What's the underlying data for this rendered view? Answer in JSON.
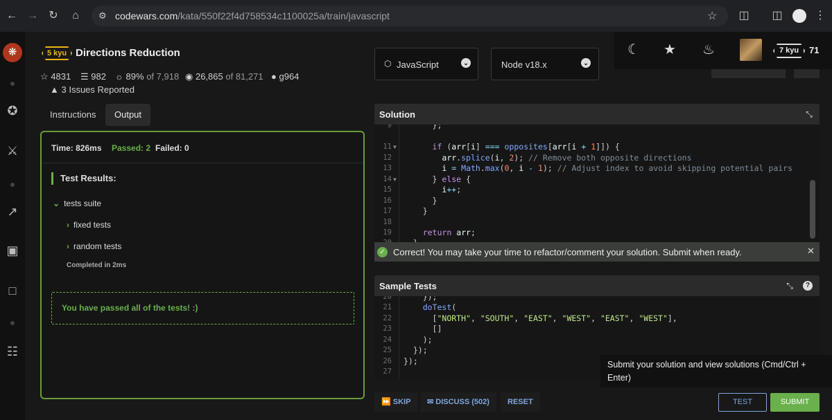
{
  "browser": {
    "url_host": "codewars.com",
    "url_path": "/kata/550f22f4d758534c1100025a/train/javascript"
  },
  "kata": {
    "rank": "5 kyu",
    "title": "Directions Reduction",
    "stars": "4831",
    "collections": "982",
    "satisfaction": "89%",
    "satisfaction_of": "of 7,918",
    "completed": "26,865",
    "completed_of": "of 81,271",
    "author": "g964",
    "issues": "3 Issues Reported"
  },
  "tabs": {
    "instructions": "Instructions",
    "output": "Output"
  },
  "output": {
    "time": "Time: 826ms",
    "passed": "Passed: 2",
    "failed": "Failed: 0",
    "results_header": "Test Results:",
    "suite": "tests suite",
    "fixed": "fixed tests",
    "random": "random tests",
    "completed_in": "Completed in 2ms",
    "pass_msg": "You have passed all of the tests! :)"
  },
  "selectors": {
    "language": "JavaScript",
    "version": "Node v18.x"
  },
  "user": {
    "rank": "7 kyu",
    "honor": "71"
  },
  "solution": {
    "title": "Solution",
    "success": "Correct! You may take your time to refactor/comment your solution. Submit when ready."
  },
  "sample_tests": {
    "title": "Sample Tests"
  },
  "tooltip": "Submit your solution and view solutions (Cmd/Ctrl + Enter)",
  "actions": {
    "skip": "SKIP",
    "discuss": "DISCUSS (502)",
    "reset": "RESET",
    "test": "TEST",
    "submit": "SUBMIT"
  }
}
